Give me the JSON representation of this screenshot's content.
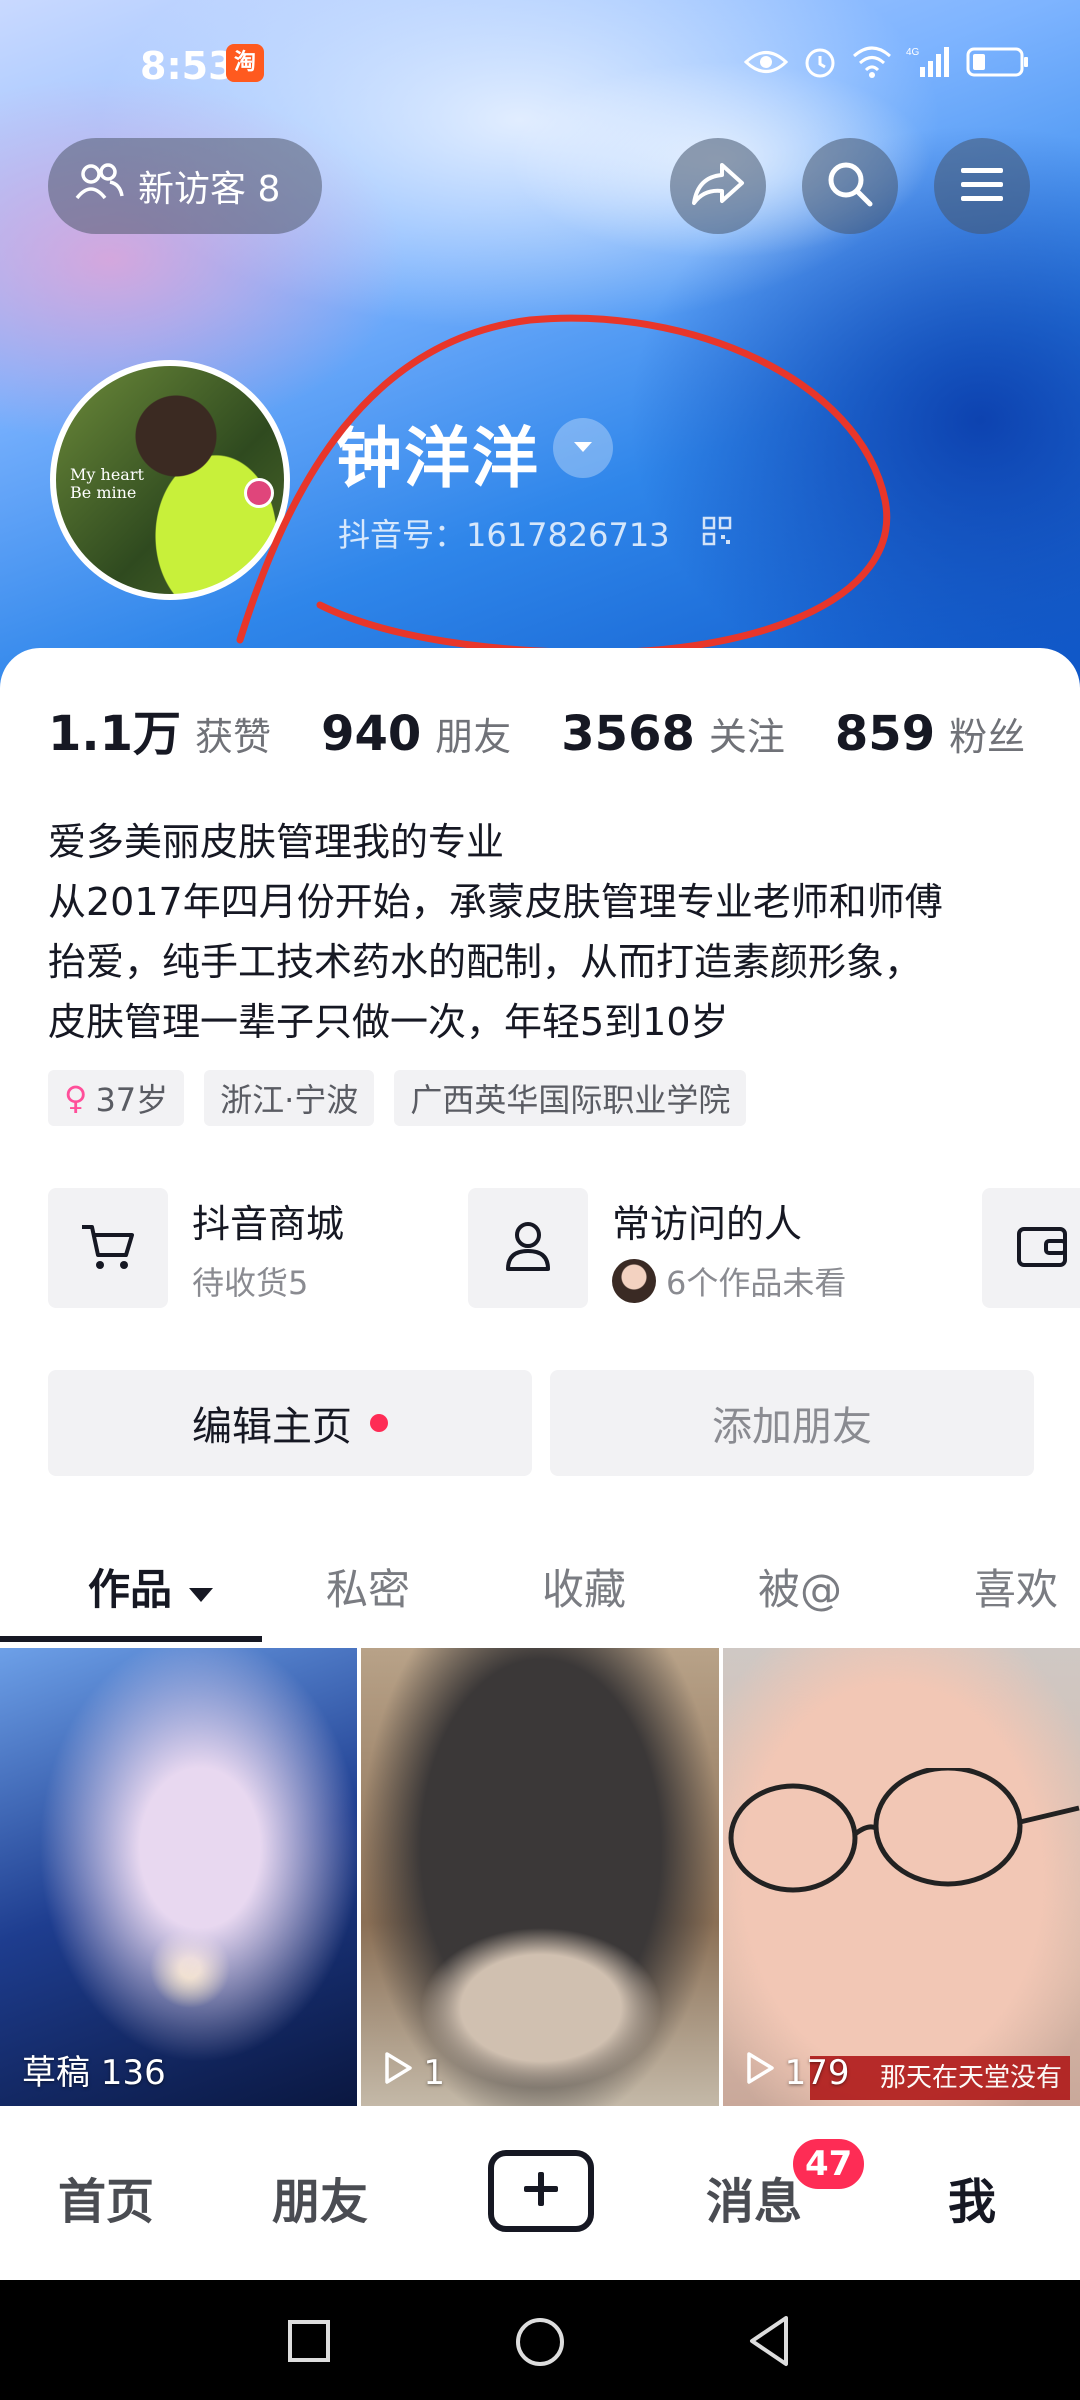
{
  "status_bar": {
    "time": "8:53",
    "app_icon_label": "淘",
    "icons": [
      "eye-icon",
      "alarm-icon",
      "wifi-icon",
      "signal-icon",
      "battery-icon"
    ],
    "network": "4G"
  },
  "top_bar": {
    "visitors_label": "新访客 8"
  },
  "profile": {
    "avatar_text": "My heart\nBe mine",
    "nickname": "钟洋洋",
    "douyin_id": "抖音号：1617826713"
  },
  "stats": [
    {
      "value": "1.1万",
      "label": "获赞"
    },
    {
      "value": "940",
      "label": "朋友"
    },
    {
      "value": "3568",
      "label": "关注"
    },
    {
      "value": "859",
      "label": "粉丝"
    }
  ],
  "bio": {
    "line1": "爱多美丽皮肤管理我的专业",
    "line2": "从2017年四月份开始，承蒙皮肤管理专业老师和师傅",
    "line3": "抬爱，纯手工技术药水的配制，从而打造素颜形象，",
    "line4": "皮肤管理一辈子只做一次，年轻5到10岁"
  },
  "tags": {
    "age": "37岁",
    "location": "浙江·宁波",
    "school": "广西英华国际职业学院"
  },
  "shortcuts": {
    "mall": {
      "title": "抖音商城",
      "subtitle": "待收货5"
    },
    "visitors": {
      "title": "常访问的人",
      "subtitle": "6个作品未看"
    }
  },
  "buttons": {
    "edit": "编辑主页",
    "add_friend": "添加朋友"
  },
  "tabs": {
    "works": "作品",
    "private": "私密",
    "favorites": "收藏",
    "mentioned": "被@",
    "likes": "喜欢"
  },
  "grid": [
    {
      "caption": "草稿 136"
    },
    {
      "caption": "1"
    },
    {
      "caption": "179",
      "banner": "那天在天堂没有灾难"
    }
  ],
  "bottom_nav": {
    "home": "首页",
    "friends": "朋友",
    "messages": "消息",
    "messages_badge": "47",
    "me": "我"
  },
  "colors": {
    "accent": "#fe2c55",
    "annotation": "#e8362a"
  }
}
